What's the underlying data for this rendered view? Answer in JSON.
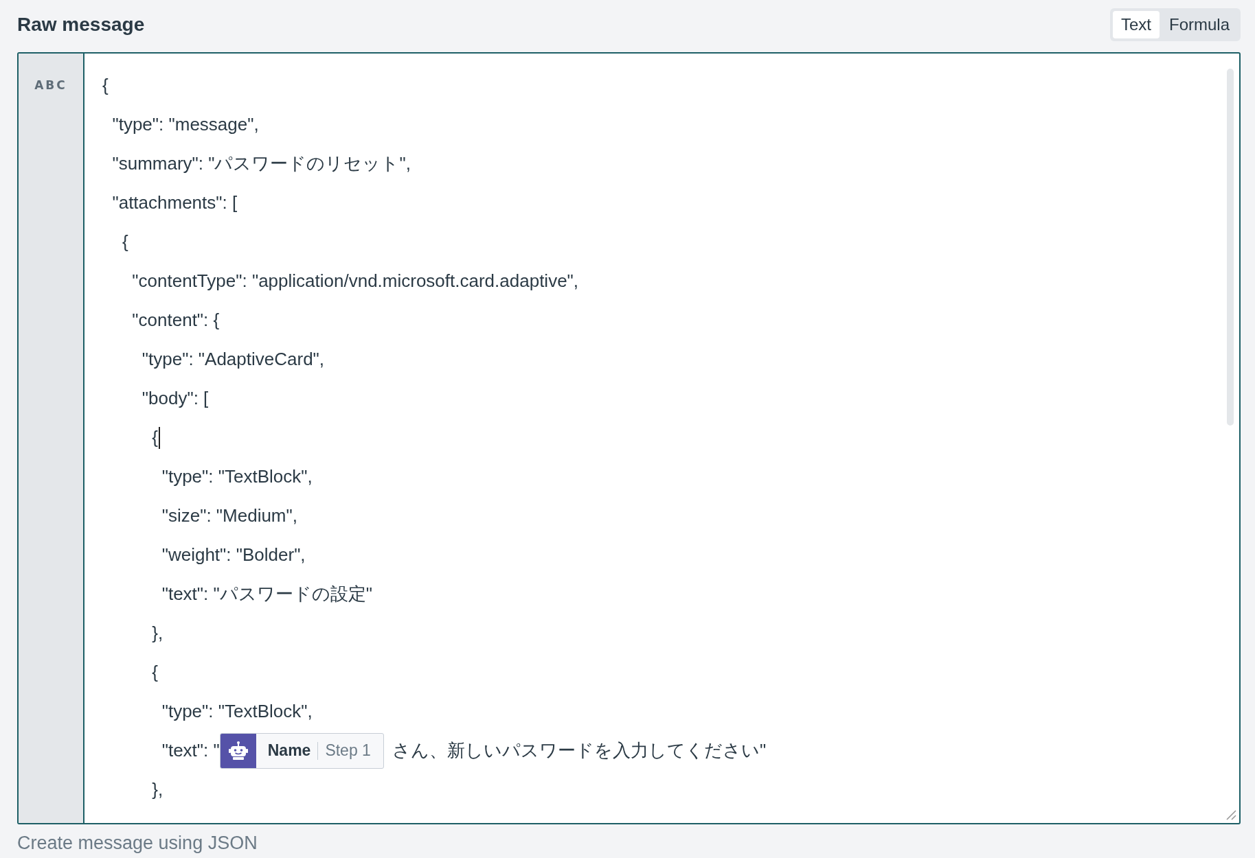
{
  "field": {
    "label": "Raw message",
    "modes": [
      {
        "label": "Text",
        "selected": true
      },
      {
        "label": "Formula",
        "selected": false
      }
    ],
    "gutter_label": "ABC",
    "lines": [
      {
        "kind": "text",
        "text": "{",
        "cursor": false
      },
      {
        "kind": "text",
        "text": "  \"type\": \"message\",",
        "cursor": false
      },
      {
        "kind": "text",
        "text": "  \"summary\": \"パスワードのリセット\",",
        "cursor": false
      },
      {
        "kind": "text",
        "text": "  \"attachments\": [",
        "cursor": false
      },
      {
        "kind": "text",
        "text": "    {",
        "cursor": false
      },
      {
        "kind": "text",
        "text": "      \"contentType\": \"application/vnd.microsoft.card.adaptive\",",
        "cursor": false
      },
      {
        "kind": "text",
        "text": "      \"content\": {",
        "cursor": false
      },
      {
        "kind": "text",
        "text": "        \"type\": \"AdaptiveCard\",",
        "cursor": false
      },
      {
        "kind": "text",
        "text": "        \"body\": [",
        "cursor": false
      },
      {
        "kind": "text",
        "text": "          {",
        "cursor": true
      },
      {
        "kind": "text",
        "text": "            \"type\": \"TextBlock\",",
        "cursor": false
      },
      {
        "kind": "text",
        "text": "            \"size\": \"Medium\",",
        "cursor": false
      },
      {
        "kind": "text",
        "text": "            \"weight\": \"Bolder\",",
        "cursor": false
      },
      {
        "kind": "text",
        "text": "            \"text\": \"パスワードの設定\"",
        "cursor": false
      },
      {
        "kind": "text",
        "text": "          },",
        "cursor": false
      },
      {
        "kind": "text",
        "text": "          {",
        "cursor": false
      },
      {
        "kind": "text",
        "text": "            \"type\": \"TextBlock\",",
        "cursor": false
      },
      {
        "kind": "pill",
        "text": "            \"text\": \"",
        "pill_name": "Name",
        "pill_step": "Step 1",
        "after": "さん、新しいパスワードを入力してください\"",
        "cursor": false
      },
      {
        "kind": "text",
        "text": "          },",
        "cursor": false
      }
    ],
    "hint": "Create message using JSON"
  }
}
